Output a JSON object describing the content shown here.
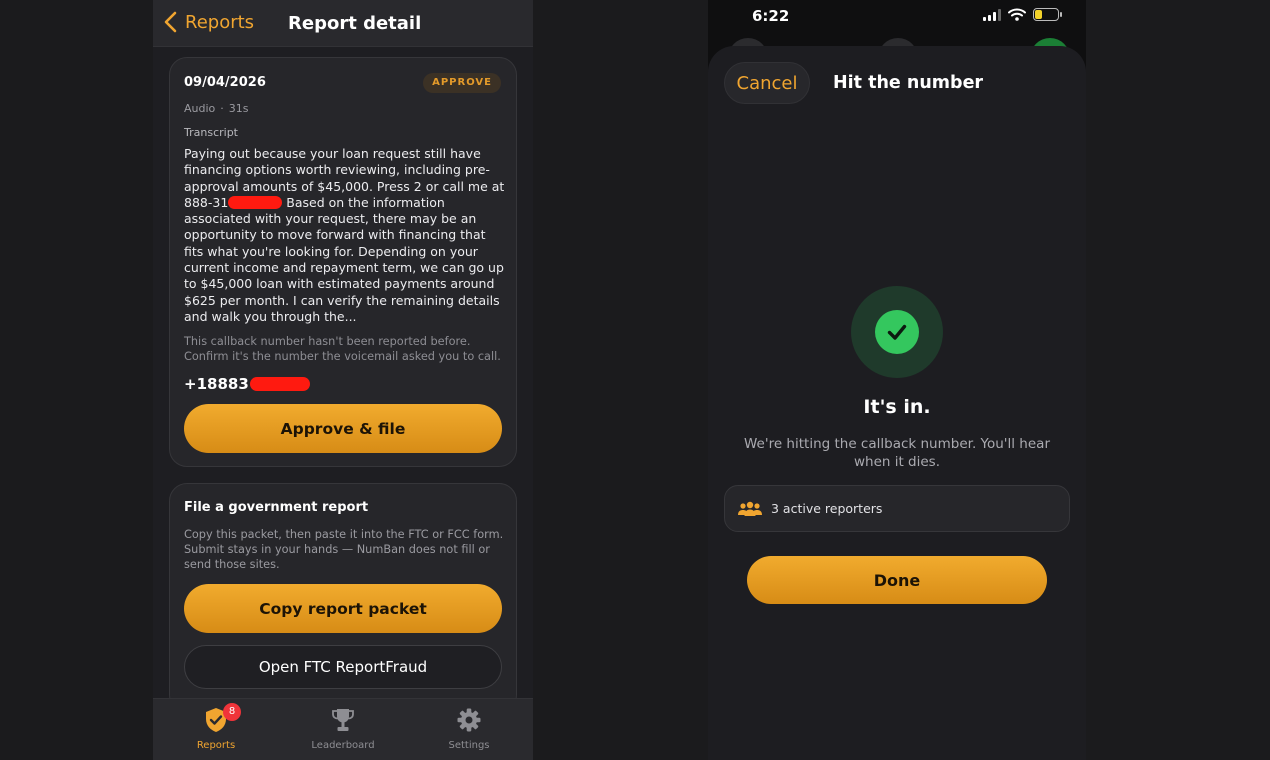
{
  "left_screen": {
    "navbar": {
      "back_label": "Reports",
      "title": "Report detail"
    },
    "report_card": {
      "date": "09/04/2026",
      "status_badge": "APPROVE",
      "media_type": "Audio",
      "separator": "·",
      "duration": "31s",
      "transcript_label": "Transcript",
      "transcript_part1": "Paying out because your loan request still have financing options worth reviewing, including pre-approval amounts of $45,000. Press 2 or call me at 888-31",
      "transcript_part2": " Based on the information associated with your request, there may be an opportunity to move forward with financing that fits what you're looking for. Depending on your current income and repayment term, we can go up to $45,000 loan with estimated payments around $625 per month. I can verify the remaining details and walk you through the...",
      "callback_note": "This callback number hasn't been reported before. Confirm it's the number the voicemail asked you to call.",
      "callback_number_prefix": "+18883",
      "approve_button": "Approve & file"
    },
    "gov_card": {
      "title": "File a government report",
      "description": "Copy this packet, then paste it into the FTC or FCC form. Submit stays in your hands — NumBan does not fill or send those sites.",
      "copy_button": "Copy report packet",
      "ftc_button": "Open FTC ReportFraud"
    },
    "tabbar": {
      "tabs": [
        {
          "label": "Reports",
          "badge": "8"
        },
        {
          "label": "Leaderboard"
        },
        {
          "label": "Settings"
        }
      ]
    }
  },
  "right_screen": {
    "status_bar": {
      "time": "6:22"
    },
    "sheet": {
      "cancel_label": "Cancel",
      "title": "Hit the number",
      "success_title": "It's in.",
      "success_description": "We're hitting the callback number. You'll hear when it dies.",
      "reporters_label": "3 active reporters",
      "done_button": "Done"
    }
  },
  "colors": {
    "accent": "#f0a530",
    "success": "#34c75e",
    "redaction": "#ff1a10",
    "badge": "#f0343a"
  },
  "icons": [
    "chevron-left-icon",
    "shield-check-icon",
    "trophy-icon",
    "gear-icon",
    "checkmark-icon",
    "people-icon",
    "signal-icon",
    "wifi-icon",
    "battery-icon"
  ]
}
